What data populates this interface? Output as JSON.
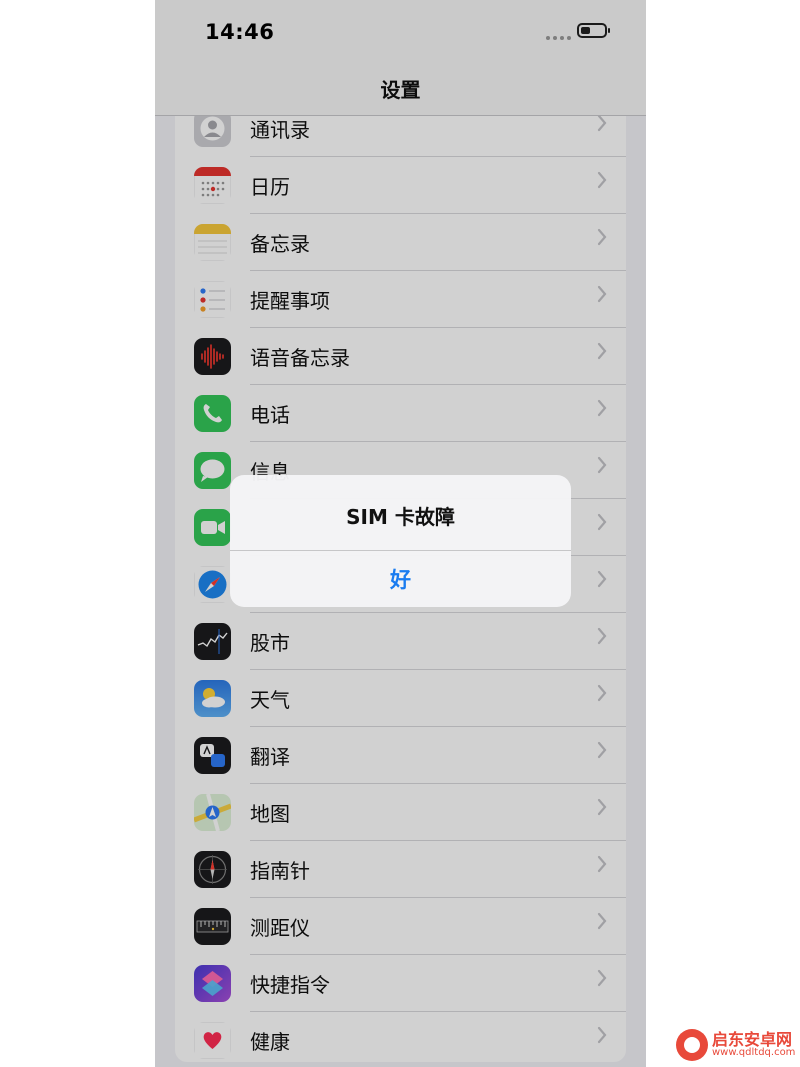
{
  "status_bar": {
    "time": "14:46"
  },
  "nav": {
    "title": "设置"
  },
  "settings_rows": [
    {
      "label": "通讯录",
      "icon": "contacts-icon"
    },
    {
      "label": "日历",
      "icon": "calendar-icon"
    },
    {
      "label": "备忘录",
      "icon": "notes-icon"
    },
    {
      "label": "提醒事项",
      "icon": "reminders-icon"
    },
    {
      "label": "语音备忘录",
      "icon": "voice-memos-icon"
    },
    {
      "label": "电话",
      "icon": "phone-icon"
    },
    {
      "label": "信息",
      "icon": "messages-icon"
    },
    {
      "label": "",
      "icon": "facetime-icon"
    },
    {
      "label": "",
      "icon": "safari-icon"
    },
    {
      "label": "股市",
      "icon": "stocks-icon"
    },
    {
      "label": "天气",
      "icon": "weather-icon"
    },
    {
      "label": "翻译",
      "icon": "translate-icon"
    },
    {
      "label": "地图",
      "icon": "maps-icon"
    },
    {
      "label": "指南针",
      "icon": "compass-icon"
    },
    {
      "label": "测距仪",
      "icon": "measure-icon"
    },
    {
      "label": "快捷指令",
      "icon": "shortcuts-icon"
    },
    {
      "label": "健康",
      "icon": "health-icon"
    }
  ],
  "alert": {
    "title": "SIM 卡故障",
    "button": "好"
  },
  "watermark": {
    "name": "启东安卓网",
    "url": "www.qdltdq.com"
  },
  "colors": {
    "accent": "#1a7cf0",
    "background": "#f2f2f7",
    "watermark": "#e8493a"
  }
}
